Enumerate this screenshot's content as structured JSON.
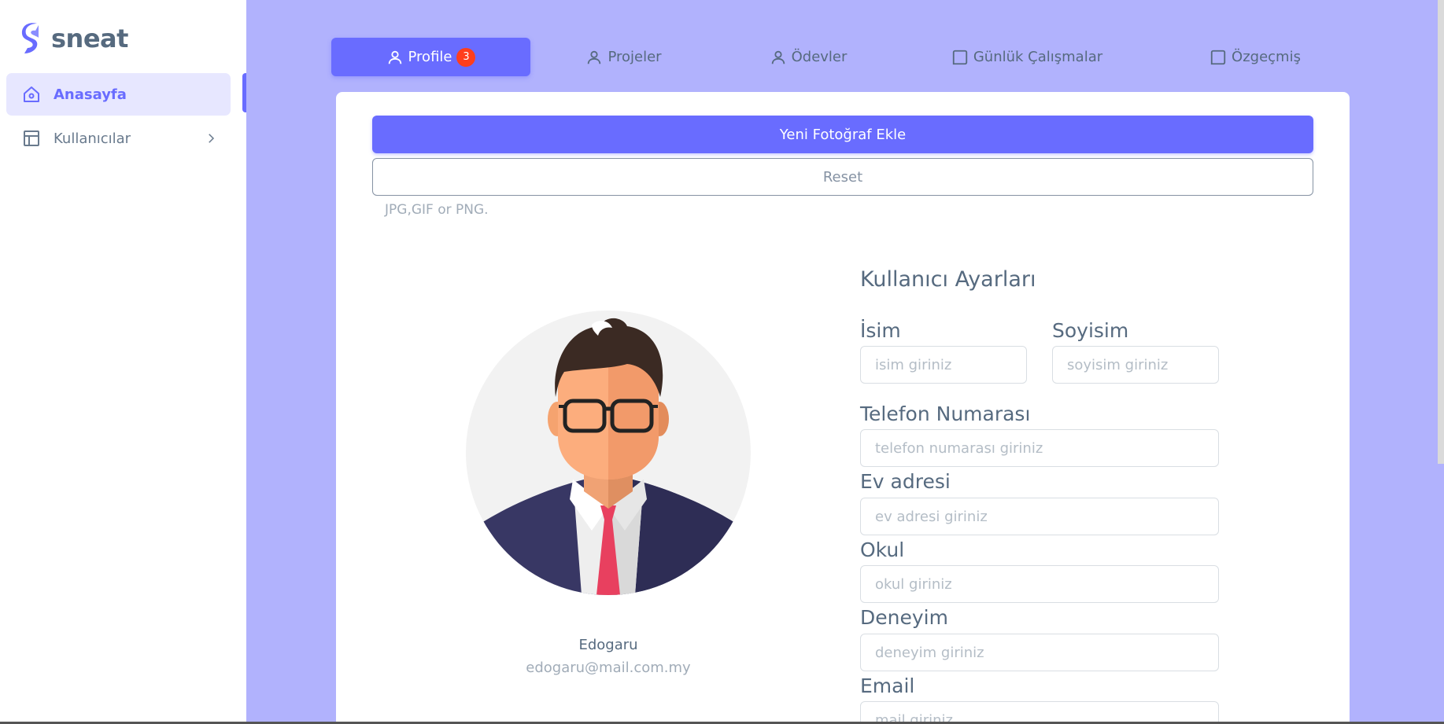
{
  "sidebar": {
    "brand": "sneat",
    "items": [
      {
        "label": "Anasayfa",
        "icon": "home-icon",
        "active": true
      },
      {
        "label": "Kullanıcılar",
        "icon": "layout-icon",
        "active": false
      }
    ]
  },
  "tabs": [
    {
      "label": "Profile",
      "badge": "3",
      "icon": "user-icon",
      "active": true
    },
    {
      "label": "Projeler",
      "icon": "user-icon"
    },
    {
      "label": "Ödevler",
      "icon": "user-icon"
    },
    {
      "label": "Günlük Çalışmalar",
      "icon": "square-icon"
    },
    {
      "label": "Özgeçmiş",
      "icon": "square-icon"
    }
  ],
  "upload": {
    "add_label": "Yeni Fotoğraf Ekle",
    "reset_label": "Reset",
    "hint": "JPG,GIF or PNG."
  },
  "profile": {
    "name": "Edogaru",
    "email": "edogaru@mail.com.my"
  },
  "form": {
    "title": "Kullanıcı Ayarları",
    "first_name": {
      "label": "İsim",
      "placeholder": "isim giriniz",
      "value": ""
    },
    "last_name": {
      "label": "Soyisim",
      "placeholder": "soyisim giriniz",
      "value": ""
    },
    "phone": {
      "label": "Telefon Numarası",
      "placeholder": "telefon numarası giriniz",
      "value": ""
    },
    "address": {
      "label": "Ev adresi",
      "placeholder": "ev adresi giriniz",
      "value": ""
    },
    "school": {
      "label": "Okul",
      "placeholder": "okul giriniz",
      "value": ""
    },
    "experience": {
      "label": "Deneyim",
      "placeholder": "deneyim giriniz",
      "value": ""
    },
    "email": {
      "label": "Email",
      "placeholder": "mail giriniz",
      "value": ""
    }
  },
  "colors": {
    "accent": "#696cff",
    "page_bg": "#b1b2fd",
    "badge": "#ff3e1d",
    "text": "#566a7f"
  }
}
